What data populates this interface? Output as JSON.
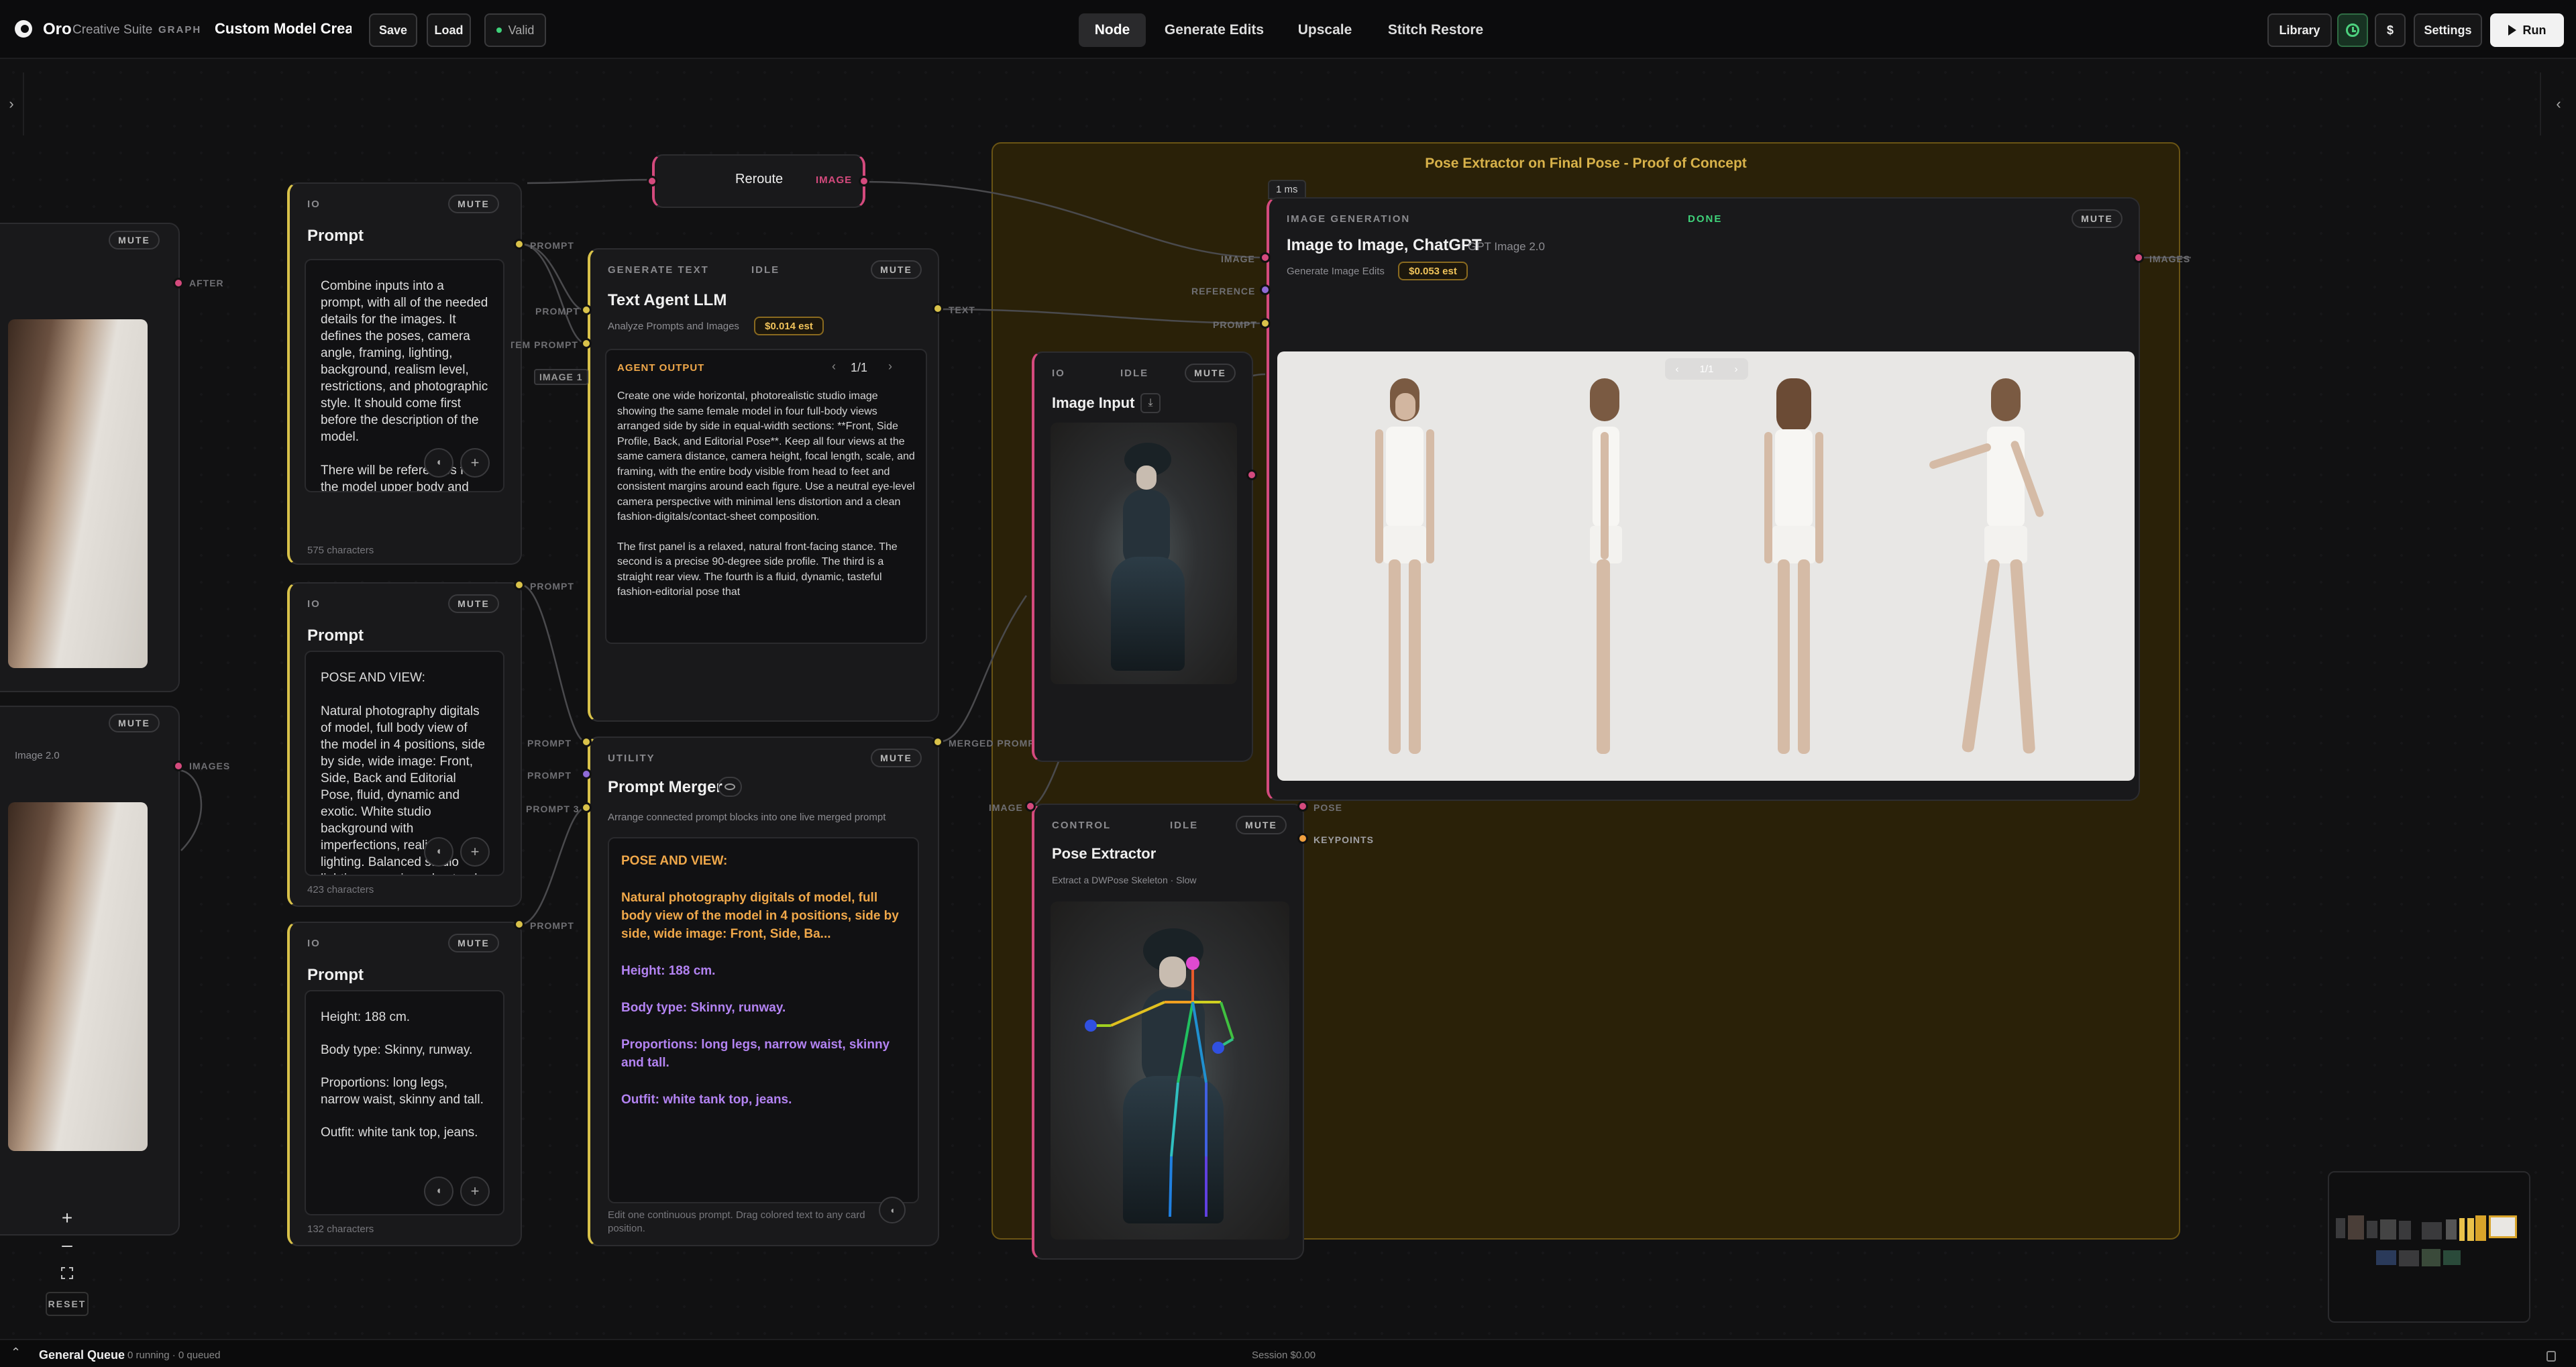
{
  "topbar": {
    "brand": "Oro",
    "suite": "Creative Suite",
    "mode": "GRAPH",
    "doc_title": "Custom Model Creati",
    "save": "Save",
    "load": "Load",
    "valid": "Valid",
    "tabs": [
      "Node",
      "Generate Edits",
      "Upscale",
      "Stitch Restore"
    ],
    "active_tab": "Node",
    "library": "Library",
    "dollar": "$",
    "settings": "Settings",
    "run": "Run"
  },
  "group": {
    "title": "Pose Extractor on Final Pose - Proof of Concept"
  },
  "left_partial": {
    "mute1": "MUTE",
    "after": "AFTER",
    "mute2": "MUTE",
    "model_fragment": "Image 2.0",
    "images": "IMAGES"
  },
  "prompt1": {
    "kind": "IO",
    "mute": "MUTE",
    "title": "Prompt",
    "p1": "Combine inputs into a prompt, with all of the needed details for the images. It defines the poses, camera angle, framing, lighting, background, realism level, restrictions, and photographic style. It should come first before the description of the model.",
    "p2": "There will be references for the model upper body and",
    "chars": "575 characters",
    "port": "PROMPT"
  },
  "prompt2": {
    "kind": "IO",
    "mute": "MUTE",
    "title": "Prompt",
    "p1": "POSE AND VIEW:",
    "p2": "Natural photography digitals of model, full body view of the model in 4 positions, side by side, wide image: Front, Side, Back and Editorial Pose, fluid, dynamic and exotic. White studio background with imperfections, realistic lighting. Balanced studio lighting, organic and natural, sharp lighting from side",
    "chars": "423 characters",
    "port": "PROMPT"
  },
  "prompt3": {
    "kind": "IO",
    "mute": "MUTE",
    "title": "Prompt",
    "lines": [
      "Height: 188 cm.",
      "Body type: Skinny, runway.",
      "Proportions: long legs, narrow waist, skinny and tall.",
      "Outfit: white tank top, jeans."
    ],
    "chars": "132 characters",
    "port": "PROMPT"
  },
  "reroute": {
    "title": "Reroute",
    "port": "IMAGE"
  },
  "text_agent": {
    "kind": "GENERATE TEXT",
    "status": "IDLE",
    "mute": "MUTE",
    "title": "Text Agent LLM",
    "sub": "Analyze Prompts and Images",
    "cost": "$0.014 est",
    "in1": "PROMPT",
    "in2": "SYSTEM PROMPT",
    "in3": "IMAGE 1",
    "out": "TEXT",
    "output_label": "AGENT OUTPUT",
    "pager": "1/1",
    "p1": "Create one wide horizontal, photorealistic studio image showing the same female model in four full-body views arranged side by side in equal-width sections: **Front, Side Profile, Back, and Editorial Pose**. Keep all four views at the same camera distance, camera height, focal length, scale, and framing, with the entire body visible from head to feet and consistent margins around each figure. Use a neutral eye-level camera perspective with minimal lens distortion and a clean fashion-digitals/contact-sheet composition.",
    "p2": "The first panel is a relaxed, natural front-facing stance. The second is a precise 90-degree side profile. The third is a straight rear view. The fourth is a fluid, dynamic, tasteful fashion-editorial pose that"
  },
  "prompt_merger": {
    "kind": "UTILITY",
    "mute": "MUTE",
    "title": "Prompt Merger",
    "sub": "Arrange connected prompt blocks into one live merged prompt",
    "in1": "PROMPT",
    "in2": "PROMPT",
    "in3": "PROMPT 3",
    "out": "MERGED PROMPT",
    "head": "POSE AND VIEW:",
    "body": "Natural photography digitals of model, full body view of the model in 4 positions, side by side, wide image: Front, Side, Ba...",
    "l1": "Height: 188 cm.",
    "l2": "Body type: Skinny, runway.",
    "l3": "Proportions: long legs, narrow waist, skinny and tall.",
    "l4": "Outfit: white tank top, jeans.",
    "footer": "Edit one continuous prompt. Drag colored text to any card position."
  },
  "image_gen": {
    "timing": "1 ms",
    "kind": "IMAGE GENERATION",
    "status": "DONE",
    "mute": "MUTE",
    "title": "Image to Image, ChatGPT",
    "model": "GPT Image 2.0",
    "sub": "Generate Image Edits",
    "cost": "$0.053 est",
    "in1": "IMAGE",
    "in2": "REFERENCE",
    "in3": "PROMPT",
    "out": "IMAGES",
    "pager": "1/1"
  },
  "image_input": {
    "kind": "IO",
    "status": "IDLE",
    "mute": "MUTE",
    "title": "Image Input"
  },
  "pose_extractor": {
    "kind": "CONTROL",
    "status": "IDLE",
    "mute": "MUTE",
    "title": "Pose Extractor",
    "sub": "Extract a DWPose Skeleton · Slow",
    "in": "IMAGE",
    "out1": "POSE",
    "out2": "KEYPOINTS"
  },
  "controls": {
    "reset": "RESET"
  },
  "bottombar": {
    "queue": "General Queue",
    "queue_status": "0 running · 0 queued",
    "session": "Session $0.00"
  },
  "colors": {
    "io": "#d9c24a",
    "pink": "#d44a7d",
    "purple": "#8f6bd6",
    "group_bg": "#2a2108",
    "group_border": "#6a5414",
    "orange_text": "#f0a84a",
    "purple_text": "#b383f2"
  }
}
